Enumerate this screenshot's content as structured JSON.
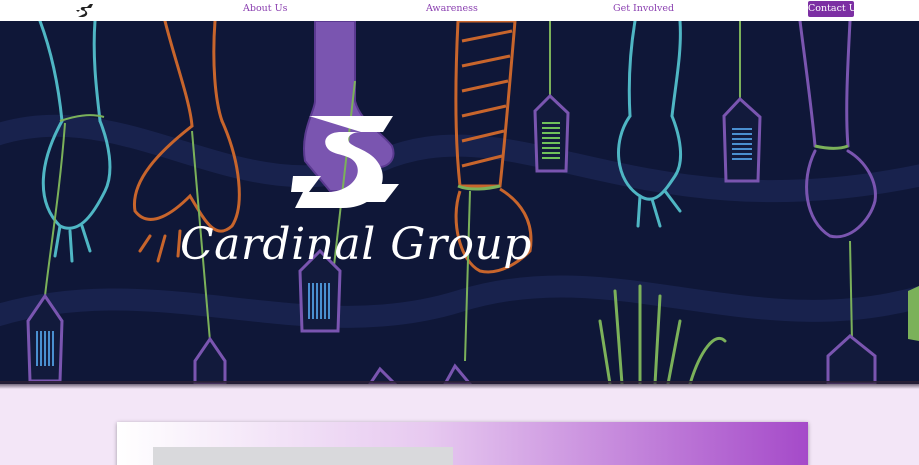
{
  "nav": {
    "logo_icon": "cardinal-group-monogram-icon",
    "links": [
      "About Us",
      "Awareness",
      "Get Involved"
    ],
    "contact_label": "Contact Us"
  },
  "hero": {
    "brand_name": "Cardinal Group",
    "brand_logo_icon": "cardinal-group-monogram-icon",
    "background_color": "#0f1738",
    "illustration": "hanging-hands-with-barcode-tags"
  },
  "colors": {
    "accent": "#7c2fa3",
    "link": "#8a3fb0",
    "page_background": "#f3e6f7",
    "hand_teal": "#4fb6c4",
    "hand_orange": "#c8652c",
    "hand_purple": "#7a55b0",
    "string_green": "#7bb15a"
  }
}
